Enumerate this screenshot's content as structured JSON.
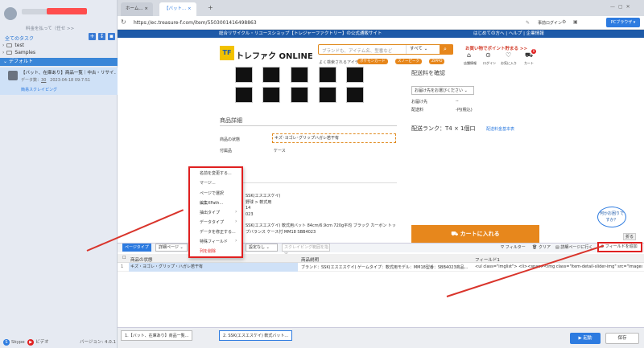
{
  "sidebar": {
    "pay_text": "料金を払って（任せ >>",
    "all_tasks": "全てのタスク",
    "tree": [
      {
        "label": "test"
      },
      {
        "label": "Samples"
      }
    ],
    "default_group": "デフォルト",
    "task": {
      "title": "【バット、在庫あり】商品一覧｜中古・リサイ...",
      "meta_label": "データ数：",
      "meta_value": "30",
      "date": "2023-04-18 09:7:51",
      "tag": "簡易スクレイピング"
    },
    "footer": {
      "skype": "Skype",
      "video": "ビデオ",
      "version": "バージョン: 4.0.1"
    }
  },
  "browser": {
    "tabs": [
      {
        "label": "ホーム..."
      },
      {
        "label": "【バット..."
      }
    ],
    "url": "https://ec.treasure-f.com/item/5503001416498863",
    "login": "事前ログイン",
    "pc_browser": "PCブラウザ"
  },
  "site": {
    "banner_left": "総合リサイクル・リユースショップ【トレジャーファクトリー】の公式通販サイト",
    "banner_right": "はじめての方へ | ヘルプ | 企業情報",
    "logo": "トレファク ONLINE",
    "search_placeholder": "ブランドも、アイテム名、型番など",
    "search_scope": "すべて",
    "popular_label": "よく検索されるアイテム",
    "pills": [
      "ポケモンカード",
      "スノーピーク",
      "ZIPPO"
    ],
    "promo": "お買い物でポイント貯まる >>",
    "nav": [
      "店舗情報",
      "ログイン",
      "お気に入り",
      "カート"
    ],
    "cart_count": "0",
    "delivery_heading": "配送料を確認",
    "delivery_select": "お届け先をお選びください",
    "delivery_to_label": "お届け先",
    "delivery_to_value": "--",
    "shipping_label": "配送料",
    "shipping_value": "-円(税込)",
    "rank_label": "配送ランク：T4 × 1個口",
    "rank_link": "配送料金基本表",
    "details_heading": "商品詳細",
    "condition_label": "商品の状態",
    "condition_value": "キズ･ヨゴレ･グリップハガレ若干有",
    "accessory_label": "付属品",
    "accessory_value": "ケース",
    "brand_frag": "SSK(エスエスケイ)",
    "cat_frag": "野球 > 軟式用",
    "model_frag": "14",
    "year_frag": "023",
    "desc_text": "SSK(エスエスケイ) 軟式用バット 84cm/6.9cm 720g平均 ブラック カーボン トップバランス ケース付 MM18 SBB4023",
    "cart_button": "カートに入れる"
  },
  "context_menu": {
    "items": [
      "名前を変更する...",
      "マージ...",
      "ページで選択",
      "編集XPath...",
      "抽出タイプ",
      "データタイプ",
      "データを修正する...",
      "特殊フィールド",
      "列を削除"
    ]
  },
  "help_bubble": "何かお困りですか？",
  "fold_label": "折る",
  "grid": {
    "page_type_btn": "ページタイプ",
    "detail_select": "詳細ページ",
    "unspecified": "設定なし",
    "scrape_range": "スクレイピング範囲を指定",
    "filter": "フィルター",
    "clear": "クリア",
    "goto_detail": "詳細ページに行く",
    "add_field": "フィールドを追加",
    "headers": [
      "商品の状態",
      "商品説明",
      "フィールド1"
    ],
    "rows": [
      {
        "num": "1",
        "c1": "キズ・ヨゴレ・グリップ・ハガレ若干有",
        "c2": "ブランド：SSK(エスエスケイ) ゲームタイプ：軟式用モデル：MM18型番：SBB4023商品...",
        "c3": "<ul class=\"imglist\"> <li><span><img class=\"item-detail-slider-img\" src=\"images"
      }
    ]
  },
  "bottom": {
    "tabs": [
      "1.【バット、在庫あり】商品一覧...",
      "2. SSK(エスエスケイ) 軟式バット..."
    ],
    "start": "起動",
    "save": "保存"
  },
  "colors": {
    "accent": "#2d7be0",
    "orange": "#e7871c",
    "navy": "#1e5aa8",
    "red": "#e02020"
  }
}
